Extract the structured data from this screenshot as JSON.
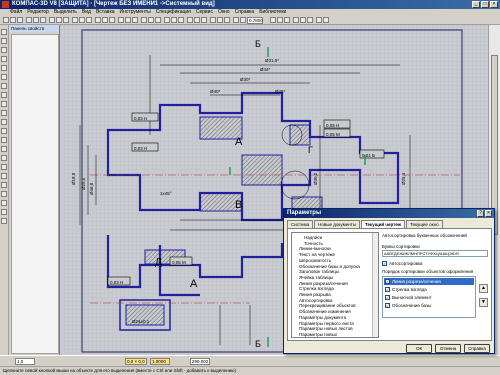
{
  "app": {
    "title": "КОМПАС-3D V8 [ЗАЩИТА] - [Чертеж БЕЗ ИМЕНИ1 ->Системный вид]",
    "accent_color": "#0a246a",
    "drawing_line_color": "#2020a0"
  },
  "menu": [
    "Файл",
    "Редактор",
    "Выделить",
    "Вид",
    "Вставка",
    "Инструменты",
    "Спецификация",
    "Сервис",
    "Окно",
    "Справка",
    "Библиотеки"
  ],
  "toolbar": {
    "zoom_value": "0.7800"
  },
  "props_panel": {
    "title": "Панель свойств"
  },
  "drawing": {
    "section_labels": [
      "Б",
      "А",
      "Г",
      "В",
      "Д",
      "А",
      "Б"
    ],
    "dimensions": [
      "Ø31,5*",
      "Ø44*",
      "Ø30*",
      "0,05 H",
      "0,03 H",
      "0,05 M",
      "0,03 H",
      "Ø40*",
      "Ø46*",
      "1x45°",
      "0,01 Б",
      "0,02 Б",
      "Ø18,8",
      "Ø25,5",
      "Ø46,8",
      "Ø30,2",
      "0,03 H",
      "0,05 M",
      "Ø25,4",
      "Ø24±0,1"
    ]
  },
  "statusbar": {
    "field1": "1,0",
    "field2": "0,0 × 0,0",
    "field3": "1.0000",
    "field4": "299.002",
    "hint": "Щелкните левой кнопкой мыши на объекте для его выделения (вместе с Ctrl или Shift - добавить к выделению)"
  },
  "dialog": {
    "title": "Параметры",
    "tabs": [
      "Система",
      "Новые документы",
      "Текущий чертеж",
      "Текущее окно"
    ],
    "active_tab": 2,
    "tree_items": [
      {
        "label": "Надписи",
        "indent": 2
      },
      {
        "label": "Точность",
        "indent": 2
      },
      {
        "label": "Линии-выноски",
        "indent": 1
      },
      {
        "label": "Текст на чертеже",
        "indent": 1
      },
      {
        "label": "Шероховатость",
        "indent": 1
      },
      {
        "label": "Обозначение базы и допуска",
        "indent": 1
      },
      {
        "label": "Заголовок таблицы",
        "indent": 1
      },
      {
        "label": "Ячейка таблицы",
        "indent": 1
      },
      {
        "label": "Линия разреза/сечения",
        "indent": 1
      },
      {
        "label": "Стрелка взгляда",
        "indent": 1
      },
      {
        "label": "Линия разрыва",
        "indent": 1
      },
      {
        "label": "Автосортировка",
        "indent": 1
      },
      {
        "label": "Перекрещивание объектов",
        "indent": 1
      },
      {
        "label": "Обозначение изменения",
        "indent": 1
      },
      {
        "label": "Параметры документа",
        "indent": 1
      },
      {
        "label": "Параметры первого листа",
        "indent": 1
      },
      {
        "label": "Параметры новых листов",
        "indent": 1
      },
      {
        "label": "Параметры новых",
        "indent": 1
      }
    ],
    "header_text": "Автосортировка буквенных обозначений",
    "sort_label": "Буквы сортировки",
    "sort_value": "АБВГДЕЖИКЛМНПРСТУФХЦЧШЩЭЮЯ",
    "autosort_label": "Автосортировка",
    "order_label": "Порядок сортировки объектов оформления",
    "order_items": [
      {
        "label": "Линия разреза/сечения",
        "checked": true,
        "selected": true
      },
      {
        "label": "Стрелка взгляда",
        "checked": true,
        "selected": false
      },
      {
        "label": "Выносной элемент",
        "checked": true,
        "selected": false
      },
      {
        "label": "Обозначение базы",
        "checked": true,
        "selected": false
      }
    ],
    "buttons": {
      "ok": "ОК",
      "cancel": "Отмена",
      "help": "Справка"
    }
  }
}
